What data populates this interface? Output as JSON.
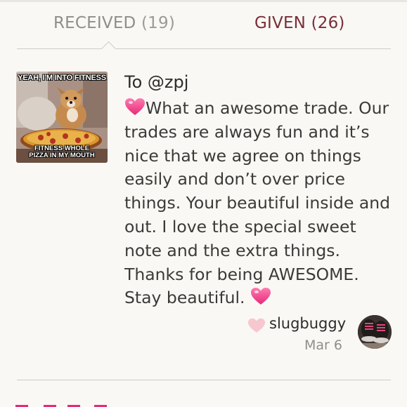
{
  "tabs": [
    {
      "label": "RECEIVED",
      "count": "(19)",
      "active": true
    },
    {
      "label": "GIVEN",
      "count": "(26)",
      "active": false
    }
  ],
  "review": {
    "meme": {
      "top_text": "YEAH, I'M INTO FITNESS",
      "bottom_text_1": "FITNESS WHOLE",
      "bottom_text_2": "PIZZA IN MY MOUTH"
    },
    "recipient": "To @zpj",
    "message_text": "What an awesome trade. Our trades are always fun and it’s nice that we agree on things easily and don’t over price things. Your beautiful inside and out. I love the special sweet note and the extra things. Thanks for being AWESOME. Stay beautiful. ",
    "author": "slugbuggy",
    "date": "Mar 6"
  },
  "icons": {
    "message_heart": "sparkling-heart-icon",
    "author_heart": "heart-icon"
  },
  "colors": {
    "background": "#f9f8f5",
    "given_tab": "#7a2e36",
    "received_tab": "#8f8f88",
    "heart_pink": "#ee3f86",
    "author_heart": "#f7c7cf"
  }
}
